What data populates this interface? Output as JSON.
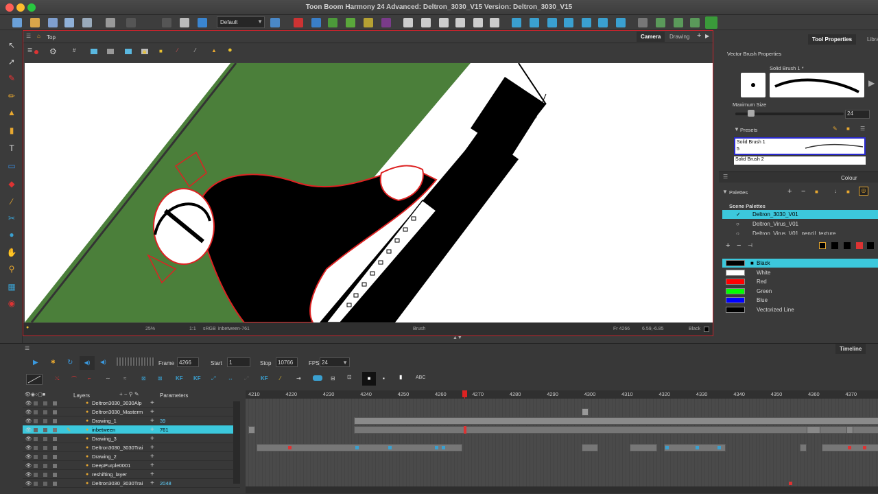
{
  "window": {
    "title": "Toon Boom Harmony 24 Advanced: Deltron_3030_V15 Version: Deltron_3030_V15"
  },
  "toolbar": {
    "workspace": "Default"
  },
  "camera_view": {
    "breadcrumb": "Top",
    "tabs": [
      "Camera",
      "Drawing"
    ],
    "status": {
      "zoom": "25%",
      "ratio": "1:1",
      "colorspace": "sRGB",
      "drawing": "inbetween-761",
      "tool": "Brush",
      "frame": "Fr 4266",
      "coords": "6.59,-6.85",
      "color": "Black"
    }
  },
  "tool_properties": {
    "tabs": [
      "Tool Properties",
      "Library"
    ],
    "heading": "Vector Brush Properties",
    "brush_name": "Solid Brush 1 *",
    "max_size_label": "Maximum Size",
    "max_size_value": "24",
    "max_size_fraction": 0.12,
    "presets_label": "Presets",
    "presets": [
      {
        "name": "Solid Brush 1",
        "size": "5"
      },
      {
        "name": "Solid Brush 2",
        "size": ""
      }
    ]
  },
  "colour_panel": {
    "tab": "Colour",
    "palettes_label": "Palettes",
    "scene_palettes_label": "Scene Palettes",
    "palettes": [
      "Deltron_3030_V01",
      "Deltron_Virus_V01",
      "Deltron_Virus_V01_pencil_texture"
    ],
    "colours": [
      {
        "name": "Black",
        "hex": "#000000"
      },
      {
        "name": "White",
        "hex": "#ffffff"
      },
      {
        "name": "Red",
        "hex": "#ff0000"
      },
      {
        "name": "Green",
        "hex": "#00ff00"
      },
      {
        "name": "Blue",
        "hex": "#0000ff"
      },
      {
        "name": "Vectorized Line",
        "hex": "#000000"
      }
    ]
  },
  "timeline": {
    "tab": "Timeline",
    "frame_label": "Frame",
    "frame": "4266",
    "start_label": "Start",
    "start": "1",
    "stop_label": "Stop",
    "stop": "10766",
    "fps_label": "FPS",
    "fps": "24",
    "layers_header": "Layers",
    "params_header": "Parameters",
    "ruler": [
      "4210",
      "4220",
      "4230",
      "4240",
      "4250",
      "4260",
      "4270",
      "4280",
      "4290",
      "4300",
      "4310",
      "4320",
      "4330",
      "4340",
      "4350",
      "4360",
      "4370"
    ],
    "layers": [
      {
        "name": "Deltron3030_3030Alp",
        "param": ""
      },
      {
        "name": "Deltron3030_Masterm",
        "param": ""
      },
      {
        "name": "Drawing_1",
        "param": "39"
      },
      {
        "name": "inbetween",
        "param": "761"
      },
      {
        "name": "Drawing_3",
        "param": ""
      },
      {
        "name": "Deltron3030_3030Trai",
        "param": ""
      },
      {
        "name": "Drawing_2",
        "param": ""
      },
      {
        "name": "DeepPurple0001",
        "param": ""
      },
      {
        "name": "reshifting_layer",
        "param": ""
      },
      {
        "name": "Deltron3030_3030Trai",
        "param": "2048"
      }
    ]
  },
  "colors": {
    "selection": "#3cc8dc",
    "accent_red": "#c7252d",
    "canvas_green": "#4b7f3a"
  }
}
